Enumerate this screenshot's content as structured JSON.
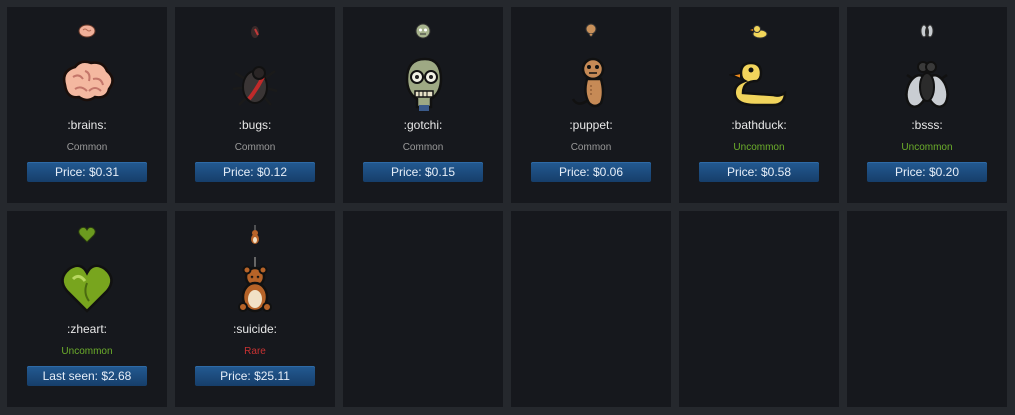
{
  "colors": {
    "common": "#9a9a9a",
    "uncommon": "#6cae2b",
    "rare": "#c83232"
  },
  "items": [
    {
      "name": ":brains:",
      "rarity": "Common",
      "price": "Price: $0.31",
      "icon": "brains-icon"
    },
    {
      "name": ":bugs:",
      "rarity": "Common",
      "price": "Price: $0.12",
      "icon": "bugs-icon"
    },
    {
      "name": ":gotchi:",
      "rarity": "Common",
      "price": "Price: $0.15",
      "icon": "gotchi-icon"
    },
    {
      "name": ":puppet:",
      "rarity": "Common",
      "price": "Price: $0.06",
      "icon": "puppet-icon"
    },
    {
      "name": ":bathduck:",
      "rarity": "Uncommon",
      "price": "Price: $0.58",
      "icon": "bathduck-icon"
    },
    {
      "name": ":bsss:",
      "rarity": "Uncommon",
      "price": "Price: $0.20",
      "icon": "bsss-icon"
    },
    {
      "name": ":zheart:",
      "rarity": "Uncommon",
      "price": "Last seen: $2.68",
      "icon": "zheart-icon"
    },
    {
      "name": ":suicide:",
      "rarity": "Rare",
      "price": "Price: $25.11",
      "icon": "suicide-icon"
    }
  ]
}
